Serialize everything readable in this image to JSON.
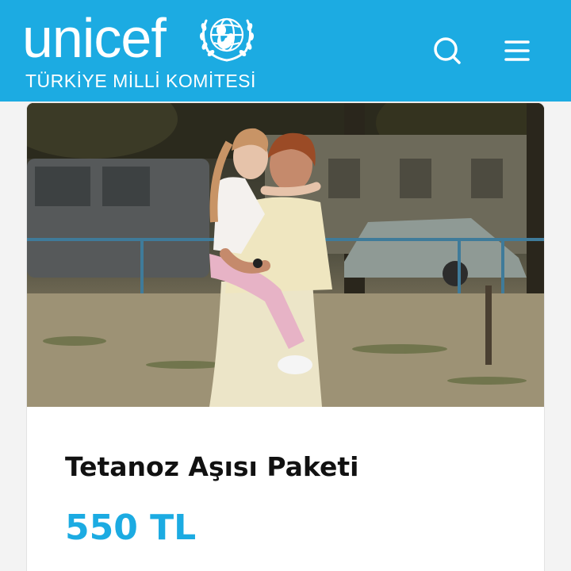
{
  "header": {
    "logo_text": "unicef",
    "logo_subtitle": "TÜRKİYE MİLLİ KOMİTESİ",
    "brand_color": "#1CABE2",
    "emblem_icon": "unicef-emblem-icon",
    "search_icon": "search-icon",
    "menu_icon": "hamburger-menu-icon"
  },
  "card": {
    "image_description_icon": "photo",
    "title": "Tetanoz Aşısı Paketi",
    "price": "550 TL",
    "price_color": "#1CABE2"
  }
}
